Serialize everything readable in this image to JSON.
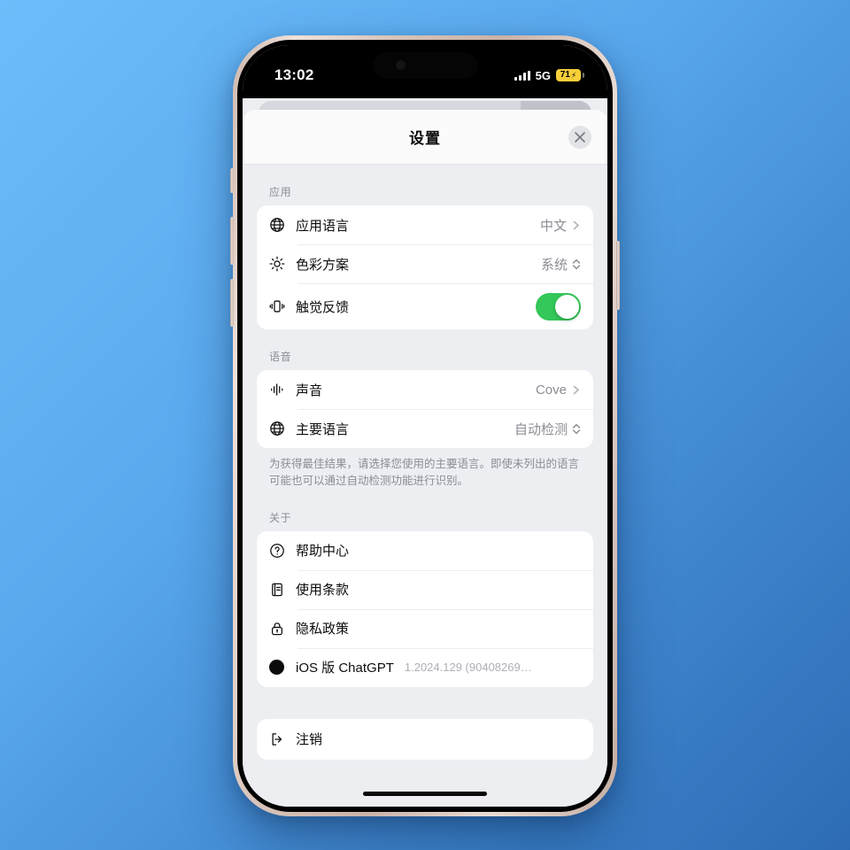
{
  "status_bar": {
    "time": "13:02",
    "network": "5G",
    "battery_percent": "71",
    "charging_glyph": "⚡",
    "battery_color": "#f7cf3a"
  },
  "sheet": {
    "title": "设置",
    "close_label": "×"
  },
  "groups": [
    {
      "label": "应用",
      "rows": [
        {
          "icon": "globe-icon",
          "label": "应用语言",
          "value": "中文",
          "accessory": "chevron"
        },
        {
          "icon": "brightness-icon",
          "label": "色彩方案",
          "value": "系统",
          "accessory": "updown"
        },
        {
          "icon": "haptics-icon",
          "label": "触觉反馈",
          "value": "",
          "accessory": "toggle",
          "toggle_on": true
        }
      ]
    },
    {
      "label": "语音",
      "rows": [
        {
          "icon": "waveform-icon",
          "label": "声音",
          "value": "Cove",
          "accessory": "chevron"
        },
        {
          "icon": "globe-icon",
          "label": "主要语言",
          "value": "自动检测",
          "accessory": "updown"
        }
      ],
      "footnote": "为获得最佳结果，请选择您使用的主要语言。即使未列出的语言可能也可以通过自动检测功能进行识别。"
    },
    {
      "label": "关于",
      "rows": [
        {
          "icon": "question-circle-icon",
          "label": "帮助中心",
          "value": "",
          "accessory": "none"
        },
        {
          "icon": "document-icon",
          "label": "使用条款",
          "value": "",
          "accessory": "none"
        },
        {
          "icon": "lock-icon",
          "label": "隐私政策",
          "value": "",
          "accessory": "none"
        },
        {
          "icon": "app-dot-icon",
          "label": "iOS 版 ChatGPT",
          "value": "1.2024.129 (90408269…",
          "accessory": "version"
        }
      ]
    }
  ],
  "logout": {
    "icon": "sign-out-icon",
    "label": "注销"
  },
  "colors": {
    "toggle_on": "#34c759",
    "sheet_background": "#eceef2",
    "card_background": "#ffffff",
    "secondary_text": "#8b8d94"
  }
}
